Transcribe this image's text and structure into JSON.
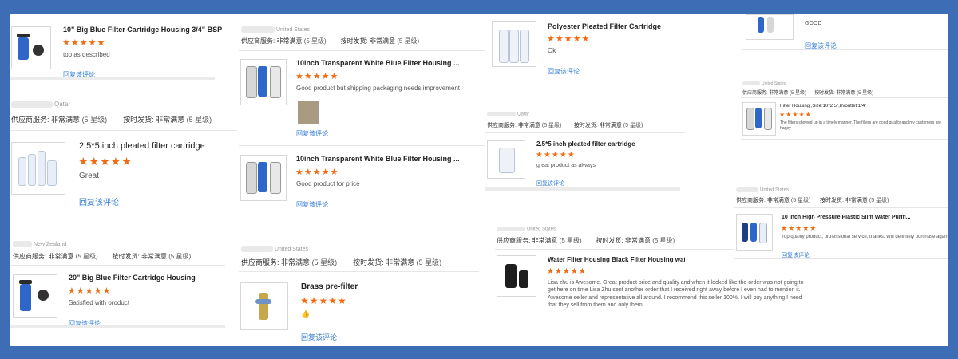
{
  "reply_label": "回复该评论",
  "labels": {
    "supplier_service": "供应商服务:",
    "on_time": "按时发货:",
    "very_satisfied": "非常满意",
    "level5": "(5 星级)"
  },
  "stars": "★★★★★",
  "countries": {
    "qatar": "Qatar",
    "us": "United States",
    "nz": "New Zealand"
  },
  "reviews": [
    {
      "title": "10\" Big Blue Filter Cartridge Housing 3/4\" BSP ...",
      "text": "top as described"
    },
    {
      "title": "2.5*5 inch pleated filter cartridge",
      "text": "Great"
    },
    {
      "title": "20\" Big Blue Filter Cartridge Housing",
      "text": "Satisfied with oroduct"
    },
    {
      "title": "10inch Transparent White Blue Filter Housing ...",
      "text": "Good product but shipping packaging needs improvement"
    },
    {
      "title": "10inch Transparent White Blue Filter Housing ...",
      "text": "Good product for price"
    },
    {
      "title": "Brass pre-filter",
      "text": "👍"
    },
    {
      "title": "Polyester Pleated Filter Cartridge",
      "text": "Ok"
    },
    {
      "title": "2.5*5 inch pleated filter cartridge",
      "text": "great product as always"
    },
    {
      "title": "Water Filter Housing Black Filter Housing wate...",
      "text": "Lisa zhu is Awesome. Great product price and quality and when it looked like the order was not going to get here on time Lisa Zhu sent another order that I received right away before I even had to mention it. Awesome seller and representative all around. I recommend this seller 100%. I will buy anything I need that they sell from them and only them"
    },
    {
      "title": "",
      "text": "GOOD"
    },
    {
      "title": "Filter Housing ,Size:10*2.5\",In/outlet:1/4\"",
      "text": "The filters showed up in a timely manner. The filters are good quality and my customers are happy"
    },
    {
      "title": "10 Inch High Pressure Plastic Slim Water Purifi...",
      "text": "Top quality product, professional service, thanks. Will definitely purchase again"
    }
  ],
  "colors": {
    "frame": "#3d6db5",
    "star": "#f26b12",
    "link": "#2f7ad6"
  }
}
